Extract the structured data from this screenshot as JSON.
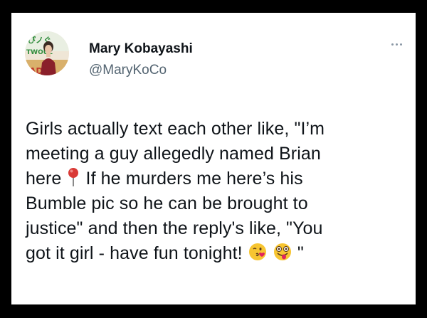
{
  "tweet": {
    "author_name": "Mary Kobayashi",
    "author_handle": "@MaryKoCo",
    "text_lines": [
      "Girls actually text each other like, \"I’m",
      "meeting a guy allegedly named Brian",
      "here",
      "If he murders me here’s his",
      "Bumble pic so he can be brought to",
      "justice\" and then the reply's like, \"You",
      "got it girl - have fun tonight!",
      "\""
    ],
    "emojis": [
      "round-pushpin-icon",
      "face-blowing-kiss-icon",
      "winking-face-with-tongue-icon"
    ],
    "more_icon": "more-options-icon"
  },
  "colors": {
    "name": "#0f1419",
    "handle": "#536471",
    "background": "#ffffff",
    "frame": "#000000"
  }
}
